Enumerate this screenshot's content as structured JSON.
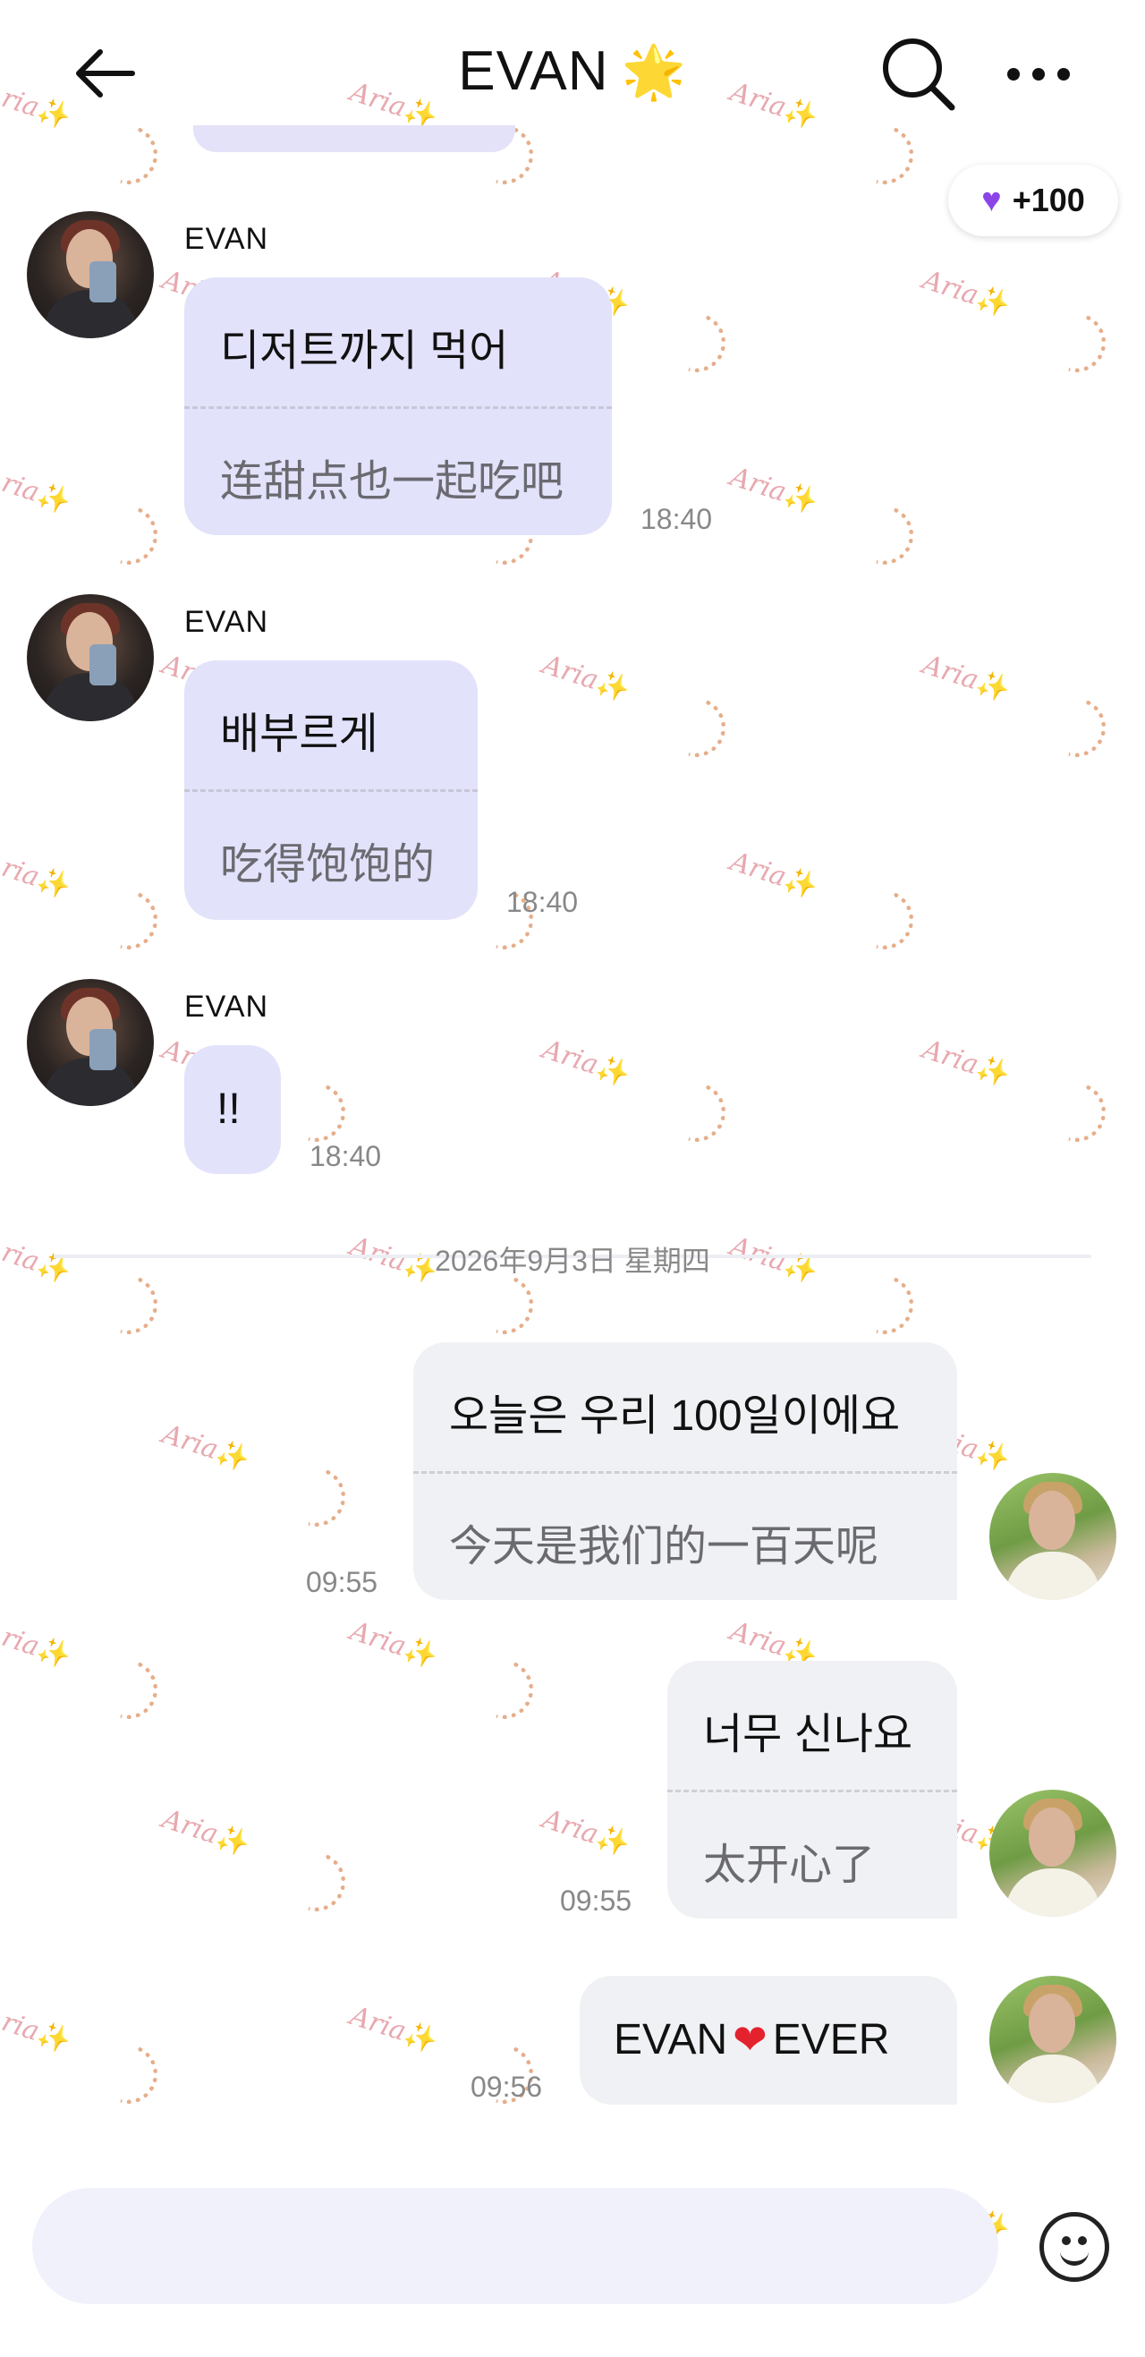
{
  "header": {
    "title": "EVAN",
    "title_emoji": "🌟"
  },
  "reward_pill": {
    "icon": "purple-heart-icon",
    "value": "+100"
  },
  "watermark": {
    "text": "Aria",
    "spark": "✨"
  },
  "messages_in": [
    {
      "sender": "EVAN",
      "ko": "디저트까지 먹어",
      "zh": "连甜点也一起吃吧",
      "time": "18:40"
    },
    {
      "sender": "EVAN",
      "ko": "배부르게",
      "zh": "吃得饱饱的",
      "time": "18:40"
    },
    {
      "sender": "EVAN",
      "ko": "!!",
      "time": "18:40"
    }
  ],
  "date_separator": "2026年9月3日 星期四",
  "messages_out": [
    {
      "ko": "오늘은 우리 100일이에요",
      "zh": "今天是我们的一百天呢",
      "time": "09:55"
    },
    {
      "ko": "너무 신나요",
      "zh": "太开心了",
      "time": "09:55"
    },
    {
      "text_before": "EVAN",
      "heart": "❤",
      "text_after": "EVER",
      "time": "09:56"
    }
  ],
  "colors": {
    "incoming_bubble": "#e3e2fb",
    "outgoing_bubble": "#f0f1f4",
    "accent_purple": "#8a44e8",
    "heart_red": "#e3222e"
  }
}
